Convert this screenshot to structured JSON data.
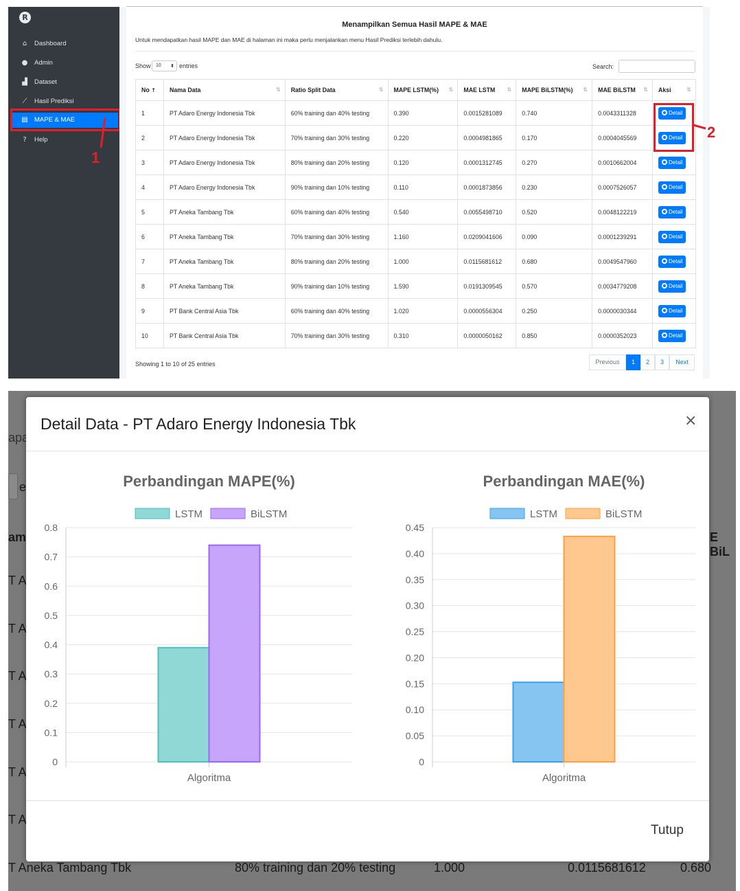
{
  "sidebar": {
    "items": [
      {
        "label": "Dashboard",
        "icon": "home-icon"
      },
      {
        "label": "Admin",
        "icon": "user-icon"
      },
      {
        "label": "Dataset",
        "icon": "area-chart-icon"
      },
      {
        "label": "Hasil Prediksi",
        "icon": "line-chart-icon"
      },
      {
        "label": "MAPE & MAE",
        "icon": "document-icon",
        "active": true
      },
      {
        "label": "Help",
        "icon": "question-icon"
      }
    ]
  },
  "annotations": {
    "label1": "1",
    "label2": "2",
    "color": "#e21f26"
  },
  "card": {
    "title": "Menampilkan Semua Hasil MAPE & MAE",
    "description": "Untuk mendapatkan hasil MAPE dan MAE di halaman ini maka perlu menjalankan menu Hasil Prediksi terlebih dahulu.",
    "show_label": "Show",
    "entries_value": "10",
    "entries_label": "entries",
    "search_label": "Search:"
  },
  "table": {
    "columns": [
      "No",
      "Nama Data",
      "Ratio Split Data",
      "MAPE LSTM(%)",
      "MAE LSTM",
      "MAPE BiLSTM(%)",
      "MAE BiLSTM",
      "Aksi"
    ],
    "button_label": "Detail",
    "rows": [
      [
        "1",
        "PT Adaro Energy Indonesia Tbk",
        "60% training dan 40% testing",
        "0.390",
        "0.0015281089",
        "0.740",
        "0.0043311328"
      ],
      [
        "2",
        "PT Adaro Energy Indonesia Tbk",
        "70% training dan 30% testing",
        "0.220",
        "0.0004981865",
        "0.170",
        "0.0004045569"
      ],
      [
        "3",
        "PT Adaro Energy Indonesia Tbk",
        "80% training dan 20% testing",
        "0.120",
        "0.0001312745",
        "0.270",
        "0.0010662004"
      ],
      [
        "4",
        "PT Adaro Energy Indonesia Tbk",
        "90% training dan 10% testing",
        "0.110",
        "0.0001873856",
        "0.230",
        "0.0007526057"
      ],
      [
        "5",
        "PT Aneka Tambang Tbk",
        "60% training dan 40% testing",
        "0.540",
        "0.0055498710",
        "0.520",
        "0.0048122219"
      ],
      [
        "6",
        "PT Aneka Tambang Tbk",
        "70% training dan 30% testing",
        "1.160",
        "0.0209041606",
        "0.090",
        "0.0001239291"
      ],
      [
        "7",
        "PT Aneka Tambang Tbk",
        "80% training dan 20% testing",
        "1.000",
        "0.0115681612",
        "0.680",
        "0.0049547960"
      ],
      [
        "8",
        "PT Aneka Tambang Tbk",
        "90% training dan 10% testing",
        "1.590",
        "0.0191309545",
        "0.570",
        "0.0034779208"
      ],
      [
        "9",
        "PT Bank Central Asia Tbk",
        "60% training dan 40% testing",
        "1.020",
        "0.0000556304",
        "0.250",
        "0.0000030344"
      ],
      [
        "10",
        "PT Bank Central Asia Tbk",
        "70% training dan 30% testing",
        "0.310",
        "0.0000050162",
        "0.850",
        "0.0000352023"
      ]
    ],
    "info": "Showing 1 to 10 of 25 entries"
  },
  "pagination": {
    "previous": "Previous",
    "pages": [
      "1",
      "2",
      "3"
    ],
    "next": "Next",
    "current": "1"
  },
  "background_rows": {
    "left_fragments": [
      "apa",
      "e",
      "am",
      "T Ad",
      "T Ad",
      "T Ad",
      "T Ad",
      "T An",
      "T An"
    ],
    "right_fragment": "E BiL",
    "last_row": [
      "T Aneka Tambang Tbk",
      "80% training dan 20% testing",
      "1.000",
      "0.0115681612",
      "0.680"
    ]
  },
  "modal": {
    "title": "Detail Data - PT Adaro Energy Indonesia Tbk",
    "close": "×",
    "close_button": "Tutup"
  },
  "chart_data": [
    {
      "type": "bar",
      "title": "Perbandingan MAPE(%)",
      "categories": [
        "Algoritma"
      ],
      "series": [
        {
          "name": "LSTM",
          "values": [
            0.39
          ],
          "color": "#8fd8d5",
          "border": "#4bc0c0"
        },
        {
          "name": "BiLSTM",
          "values": [
            0.74
          ],
          "color": "#c6a5fb",
          "border": "#9966ff"
        }
      ],
      "ylim": [
        0,
        0.8
      ],
      "yticks": [
        "0",
        "0.1",
        "0.2",
        "0.3",
        "0.4",
        "0.5",
        "0.6",
        "0.7",
        "0.8"
      ],
      "legend": "top",
      "grid": true
    },
    {
      "type": "bar",
      "title": "Perbandingan MAE(%)",
      "categories": [
        "Algoritma"
      ],
      "series": [
        {
          "name": "LSTM",
          "values": [
            0.1528
          ],
          "color": "#86c5f2",
          "border": "#36a2eb"
        },
        {
          "name": "BiLSTM",
          "values": [
            0.4331
          ],
          "color": "#fec88f",
          "border": "#ff9f40"
        }
      ],
      "ylim": [
        0,
        0.45
      ],
      "yticks": [
        "0",
        "0.05",
        "0.10",
        "0.15",
        "0.20",
        "0.25",
        "0.30",
        "0.35",
        "0.40",
        "0.45"
      ],
      "legend": "top",
      "grid": true
    }
  ]
}
